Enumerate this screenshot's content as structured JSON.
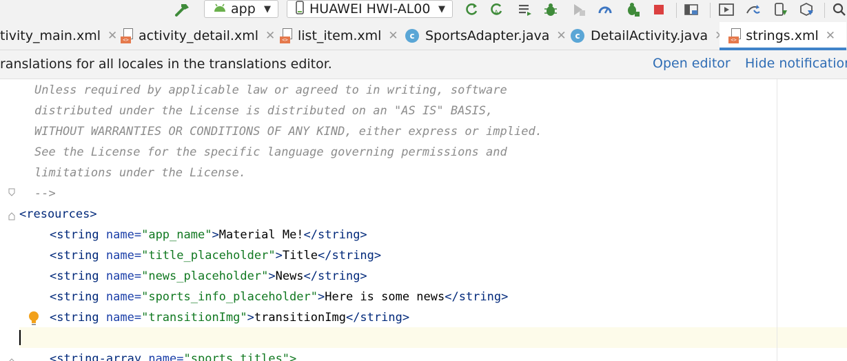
{
  "toolbar": {
    "run_config": "app",
    "device": "HUAWEI HWI-AL00"
  },
  "tabs": [
    {
      "label": "tivity_main.xml",
      "icon": "xml-file-icon",
      "active": false
    },
    {
      "label": "activity_detail.xml",
      "icon": "xml-file-icon",
      "active": false
    },
    {
      "label": "list_item.xml",
      "icon": "xml-file-icon",
      "active": false
    },
    {
      "label": "SportsAdapter.java",
      "icon": "java-class-icon",
      "active": false
    },
    {
      "label": "DetailActivity.java",
      "icon": "java-class-icon",
      "active": false
    },
    {
      "label": "strings.xml",
      "icon": "strings-xml-icon",
      "active": true
    }
  ],
  "notification": {
    "message": "ranslations for all locales in the translations editor.",
    "open_editor": "Open editor",
    "hide_notification": "Hide notification"
  },
  "code": {
    "comment1": "Unless required by applicable law or agreed to in writing, software",
    "comment2": "distributed under the License is distributed on an \"AS IS\" BASIS,",
    "comment3": "WITHOUT WARRANTIES OR CONDITIONS OF ANY KIND, either express or implied.",
    "comment4": "See the License for the specific language governing permissions and",
    "comment5": "limitations under the License.",
    "comment_end": "-->",
    "resources_open": "<resources>",
    "strings": [
      {
        "name": "app_name",
        "value": "Material Me!"
      },
      {
        "name": "title_placeholder",
        "value": "Title"
      },
      {
        "name": "news_placeholder",
        "value": "News"
      },
      {
        "name": "sports_info_placeholder",
        "value": "Here is some news"
      },
      {
        "name": "transitionImg",
        "value": "transitionImg"
      }
    ],
    "array_tag": "<string-array",
    "array_attr": "name",
    "array_value": "\"sports_titles\">"
  },
  "colors": {
    "tag": "#00287a",
    "attr": "#1a3ea8",
    "value": "#107820",
    "comment": "#8c8c8c",
    "link": "#2f6db5",
    "tab_underline": "#4083c9"
  }
}
